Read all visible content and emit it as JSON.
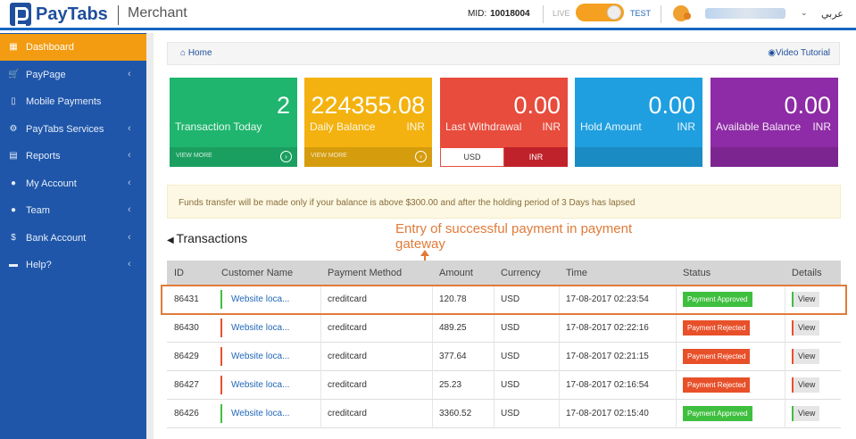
{
  "header": {
    "brand": "PayTabs",
    "subtitle": "Merchant",
    "mid_label": "MID:",
    "mid_value": "10018004",
    "mode_live": "LIVE",
    "mode_test": "TEST",
    "language": "عربي"
  },
  "sidebar": {
    "items": [
      {
        "label": "Dashboard",
        "icon": "dashboard-icon",
        "glyph": "▦",
        "has_caret": false
      },
      {
        "label": "PayPage",
        "icon": "cart-icon",
        "glyph": "🛒",
        "has_caret": true
      },
      {
        "label": "Mobile Payments",
        "icon": "mobile-icon",
        "glyph": "▯",
        "has_caret": false
      },
      {
        "label": "PayTabs Services",
        "icon": "gear-icon",
        "glyph": "⚙",
        "has_caret": true
      },
      {
        "label": "Reports",
        "icon": "chart-icon",
        "glyph": "▤",
        "has_caret": true
      },
      {
        "label": "My Account",
        "icon": "user-icon",
        "glyph": "●",
        "has_caret": true
      },
      {
        "label": "Team",
        "icon": "team-icon",
        "glyph": "●",
        "has_caret": true
      },
      {
        "label": "Bank Account",
        "icon": "dollar-icon",
        "glyph": "$",
        "has_caret": true
      },
      {
        "label": "Help?",
        "icon": "book-icon",
        "glyph": "▬",
        "has_caret": true
      }
    ]
  },
  "breadcrumb": {
    "home": "Home",
    "video": "Video Tutorial"
  },
  "stats": [
    {
      "value": "2",
      "label": "Transaction Today",
      "foot": "VIEW MORE",
      "color": "#1fb56e"
    },
    {
      "value": "224355.08",
      "label": "Daily Balance",
      "currency": "INR",
      "foot": "VIEW MORE",
      "color": "#f3b20f"
    },
    {
      "value": "0.00",
      "label": "Last Withdrawal",
      "currency": "INR",
      "usd": "USD",
      "inr": "INR",
      "color": "#e74c3c"
    },
    {
      "value": "0.00",
      "label": "Hold Amount",
      "currency": "INR",
      "color": "#1f9fe0"
    },
    {
      "value": "0.00",
      "label": "Available Balance",
      "currency": "INR",
      "color": "#8e2ba6"
    }
  ],
  "notice": "Funds transfer will be made only if your balance is above $300.00 and after the holding period of 3 Days has lapsed",
  "transactions_title": "Transactions",
  "annotation": "Entry of successful payment in payment gateway",
  "table": {
    "headers": [
      "ID",
      "Customer Name",
      "Payment Method",
      "Amount",
      "Currency",
      "Time",
      "Status",
      "Details"
    ],
    "rows": [
      {
        "id": "86431",
        "customer": "Website loca...",
        "method": "creditcard",
        "amount": "120.78",
        "currency": "USD",
        "time": "17-08-2017 02:23:54",
        "status": "Payment Approved",
        "view": "View"
      },
      {
        "id": "86430",
        "customer": "Website loca...",
        "method": "creditcard",
        "amount": "489.25",
        "currency": "USD",
        "time": "17-08-2017 02:22:16",
        "status": "Payment Rejected",
        "view": "View"
      },
      {
        "id": "86429",
        "customer": "Website loca...",
        "method": "creditcard",
        "amount": "377.64",
        "currency": "USD",
        "time": "17-08-2017 02:21:15",
        "status": "Payment Rejected",
        "view": "View"
      },
      {
        "id": "86427",
        "customer": "Website loca...",
        "method": "creditcard",
        "amount": "25.23",
        "currency": "USD",
        "time": "17-08-2017 02:16:54",
        "status": "Payment Rejected",
        "view": "View"
      },
      {
        "id": "86426",
        "customer": "Website loca...",
        "method": "creditcard",
        "amount": "3360.52",
        "currency": "USD",
        "time": "17-08-2017 02:15:40",
        "status": "Payment Approved",
        "view": "View"
      }
    ]
  },
  "colors": {
    "approved": "#3fbf3f",
    "rejected": "#e8502a",
    "accent": "#1f56a9"
  }
}
